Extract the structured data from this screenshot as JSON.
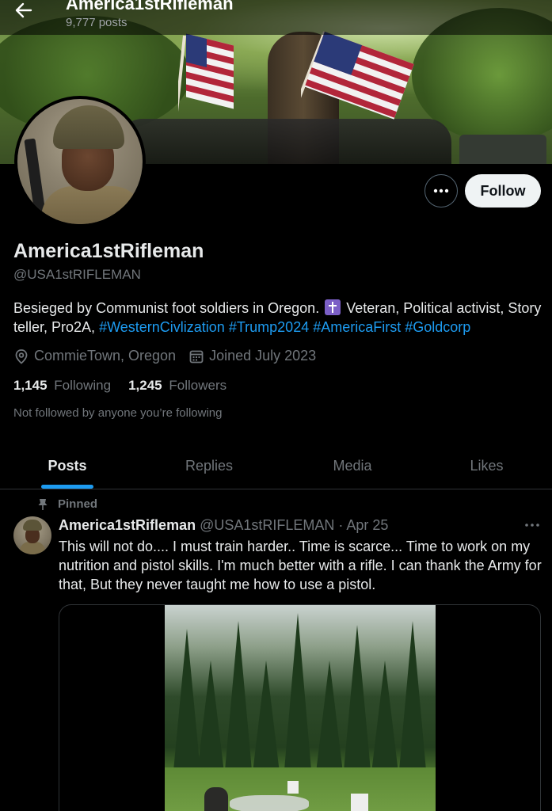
{
  "header": {
    "name": "America1stRifleman",
    "posts_count": "9,777 posts"
  },
  "profile": {
    "display_name": "America1stRifleman",
    "handle": "@USA1stRIFLEMAN",
    "follow_label": "Follow",
    "bio_text": "Besieged by Communist foot soldiers in Oregon.",
    "bio_text2": "Veteran, Political activist, Story teller, Pro2A,",
    "hashtags": [
      "#WesternCivlization",
      "#Trump2024",
      "#AmericaFirst",
      "#Goldcorp"
    ],
    "location": "CommieTown, Oregon",
    "joined": "Joined July 2023",
    "following_count": "1,145",
    "following_label": "Following",
    "followers_count": "1,245",
    "followers_label": "Followers",
    "not_followed": "Not followed by anyone you’re following"
  },
  "tabs": [
    {
      "label": "Posts",
      "active": true
    },
    {
      "label": "Replies",
      "active": false
    },
    {
      "label": "Media",
      "active": false
    },
    {
      "label": "Likes",
      "active": false
    }
  ],
  "tweet": {
    "pinned_label": "Pinned",
    "author": "America1stRifleman",
    "handle": "@USA1stRIFLEMAN",
    "date": "· Apr 25",
    "text": "This will not do.... I must train harder.. Time is scarce... Time to work on my nutrition and pistol skills. I'm much better with a rifle. I can thank the Army for that, But they never taught me how to use a pistol."
  },
  "colors": {
    "accent": "#1d9bf0",
    "background": "#000000",
    "text_primary": "#e7e9ea",
    "text_secondary": "#71767b"
  },
  "icons": [
    "back-arrow-icon",
    "more-dots-icon",
    "location-pin-icon",
    "calendar-icon",
    "pin-icon",
    "tweet-more-icon"
  ]
}
